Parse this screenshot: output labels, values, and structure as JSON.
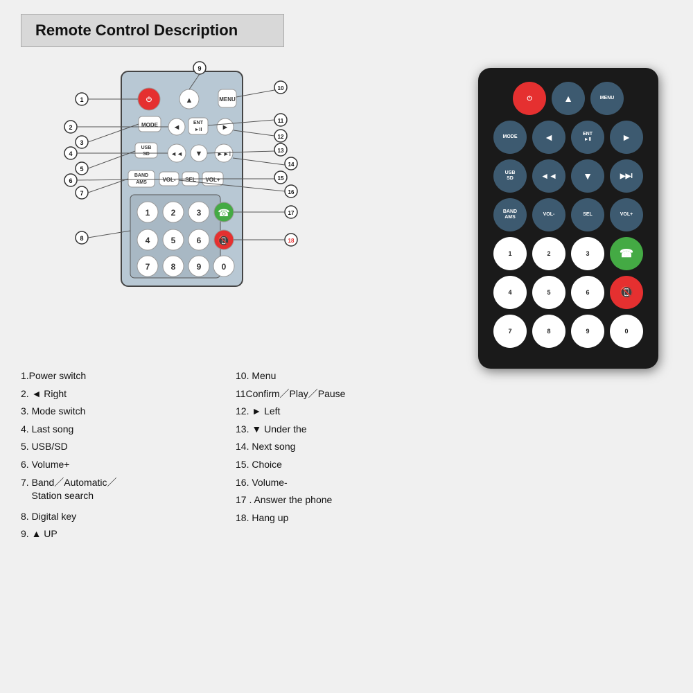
{
  "header": {
    "title": "Remote Control Description"
  },
  "descriptions": {
    "left": [
      {
        "num": "1.",
        "text": "Power switch"
      },
      {
        "num": "2.",
        "text": "◄ Right"
      },
      {
        "num": "3.",
        "text": "Mode switch"
      },
      {
        "num": "4.",
        "text": "Last song"
      },
      {
        "num": "5.",
        "text": "USB/SD"
      },
      {
        "num": "6.",
        "text": "Volume+"
      },
      {
        "num": "7.",
        "text": "Band／Automatic／",
        "text2": "Station search"
      },
      {
        "num": "8.",
        "text": "Digital key"
      },
      {
        "num": "9.",
        "text": "▲ UP"
      }
    ],
    "right": [
      {
        "num": "10.",
        "text": "Menu"
      },
      {
        "num": "11",
        "text": "Confirm／Play／Pause"
      },
      {
        "num": "12.",
        "text": "► Left"
      },
      {
        "num": "13.",
        "text": "▼  Under the"
      },
      {
        "num": "14.",
        "text": "Next song"
      },
      {
        "num": "15.",
        "text": "Choice"
      },
      {
        "num": "16.",
        "text": "Volume-"
      },
      {
        "num": "17.",
        "text": "Answer the phone"
      },
      {
        "num": "18.",
        "text": "Hang up"
      }
    ]
  },
  "remote": {
    "rows": [
      [
        "power",
        "",
        "up",
        "",
        "menu"
      ],
      [
        "mode",
        "left",
        "ent-play",
        "right",
        ""
      ],
      [
        "usb-sd",
        "prev",
        "down",
        "next",
        ""
      ],
      [
        "band-ams",
        "vol-minus",
        "sel",
        "vol-plus",
        ""
      ],
      [
        "1",
        "2",
        "3",
        "green-call",
        ""
      ],
      [
        "4",
        "5",
        "6",
        "red-call",
        ""
      ],
      [
        "7",
        "8",
        "9",
        "0",
        ""
      ]
    ],
    "labels": {
      "power": "",
      "up": "▲",
      "menu": "MENU",
      "mode": "MODE",
      "left": "◄",
      "ent-play": "ENT\n►II",
      "right": "►",
      "usb-sd": "USB\nSD",
      "prev": "◄◄",
      "down": "▼",
      "next": "►►I",
      "band-ams": "BAND\nAMS",
      "vol-minus": "VOL-",
      "sel": "SEL",
      "vol-plus": "VOL+",
      "1": "1",
      "2": "2",
      "3": "3",
      "4": "4",
      "5": "5",
      "6": "6",
      "7": "7",
      "8": "8",
      "9": "9",
      "0": "0",
      "green-call": "📞",
      "red-call": "📵"
    }
  }
}
